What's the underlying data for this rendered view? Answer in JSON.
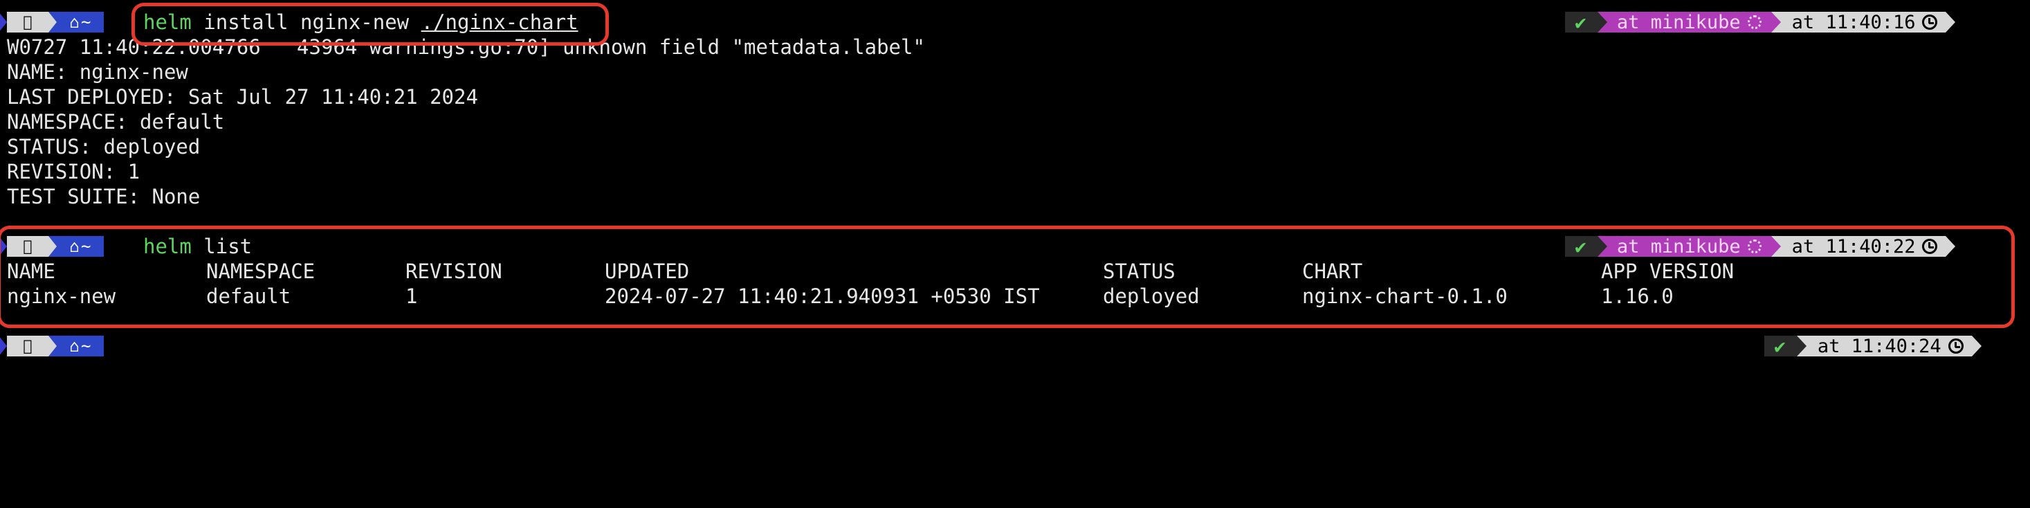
{
  "theme": {
    "background": "#000000",
    "text": "#e6e6e6",
    "command_keyword": "#5fd35f",
    "highlight_box": "#e53a2b",
    "kube_segment": "#b03bb8",
    "home_segment": "#2c46c7"
  },
  "prompt_icons": {
    "apple": "apple-icon",
    "home": "home-icon",
    "check": "checkmark-icon",
    "helm": "helm-wheel-icon",
    "clock": "clock-icon"
  },
  "prompts": [
    {
      "dir": "~",
      "command_keyword": "helm",
      "command_args": " install nginx-new ",
      "command_path": "./nginx-chart",
      "check": "✔",
      "context": "at minikube",
      "time": "at 11:40:16"
    },
    {
      "dir": "~",
      "command_keyword": "helm",
      "command_args": " list",
      "check": "✔",
      "context": "at minikube",
      "time": "at 11:40:22"
    },
    {
      "dir": "~",
      "check": "✔",
      "time": "at 11:40:24"
    }
  ],
  "install_output": [
    "W0727 11:40:22.004766   43964 warnings.go:70] unknown field \"metadata.label\"",
    "NAME: nginx-new",
    "LAST DEPLOYED: Sat Jul 27 11:40:21 2024",
    "NAMESPACE: default",
    "STATUS: deployed",
    "REVISION: 1",
    "TEST SUITE: None"
  ],
  "list_table": {
    "headers": [
      "NAME",
      "NAMESPACE",
      "REVISION",
      "UPDATED",
      "STATUS",
      "CHART",
      "APP VERSION"
    ],
    "rows": [
      [
        "nginx-new",
        "default",
        "1",
        "2024-07-27 11:40:21.940931 +0530 IST",
        "deployed",
        "nginx-chart-0.1.0",
        "1.16.0"
      ]
    ]
  }
}
